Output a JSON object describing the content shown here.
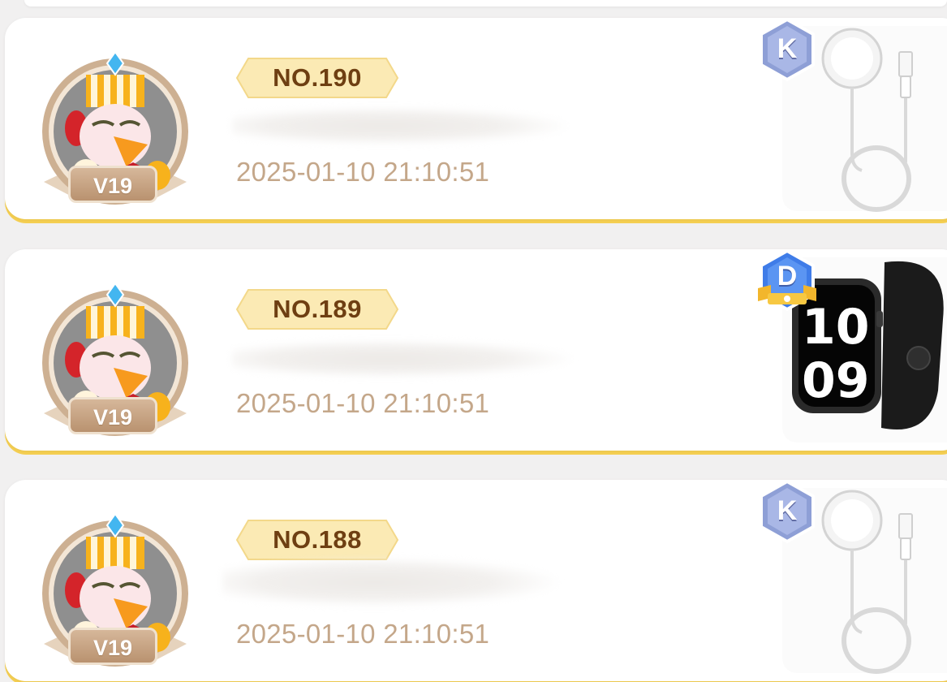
{
  "records": [
    {
      "rank": "NO.190",
      "level": "V19",
      "time": "2025-01-10 21:10:51",
      "grade": "K",
      "prize_icon": "charging-cable-icon"
    },
    {
      "rank": "NO.189",
      "level": "V19",
      "time": "2025-01-10 21:10:51",
      "grade": "D",
      "prize_icon": "smart-watch-icon"
    },
    {
      "rank": "NO.188",
      "level": "V19",
      "time": "2025-01-10 21:10:51",
      "grade": "K",
      "prize_icon": "charging-cable-icon"
    }
  ],
  "colors": {
    "card_background": "#ffffff",
    "card_accent_bottom": "#f5cf52",
    "rank_tag_fill": "#fbeab4",
    "rank_text": "#6e3f12",
    "timestamp_text": "#c4a78a",
    "level_badge": "#c4a080",
    "grade_k": "#8e9fd6",
    "grade_d": "#3f7ce8"
  }
}
